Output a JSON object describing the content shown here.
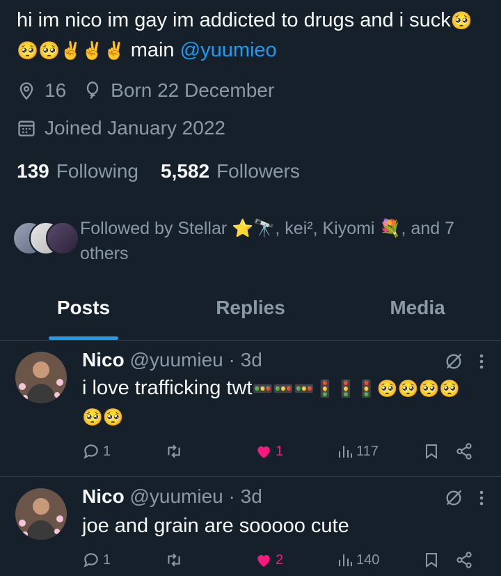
{
  "profile": {
    "bio_text": "hi im nico im gay im addicted to drugs and i suck",
    "bio_emojis": "🥺🥺🥺✌️✌️✌️",
    "bio_main": "main",
    "bio_mention": "@yuumieo",
    "location": "16",
    "birthday": "Born 22 December",
    "joined": "Joined January 2022",
    "following_count": "139",
    "following_label": "Following",
    "followers_count": "5,582",
    "followers_label": "Followers",
    "followed_by": "Followed by Stellar ⭐🔭, kei², Kiyomi 💐, and 7 others"
  },
  "tabs": [
    {
      "label": "Posts",
      "active": true
    },
    {
      "label": "Replies",
      "active": false
    },
    {
      "label": "Media",
      "active": false
    }
  ],
  "posts": [
    {
      "name": "Nico",
      "handle": "@yuumieu",
      "time": "· 3d",
      "text": "i love trafficking twt",
      "emojis": "🚥🚥🚥🚦🚦🚦🥺🥺🥺🥺🥺🥺",
      "replies": "1",
      "retweets": "",
      "likes": "1",
      "views": "117"
    },
    {
      "name": "Nico",
      "handle": "@yuumieu",
      "time": "· 3d",
      "text": "joe and grain are sooooo cute",
      "emojis": "",
      "replies": "1",
      "retweets": "",
      "likes": "2",
      "views": "140"
    }
  ],
  "colors": {
    "background": "#15202b",
    "accent": "#1d9bf0",
    "like": "#f91880",
    "muted": "#8b98a5",
    "text": "#f7f9f9"
  }
}
